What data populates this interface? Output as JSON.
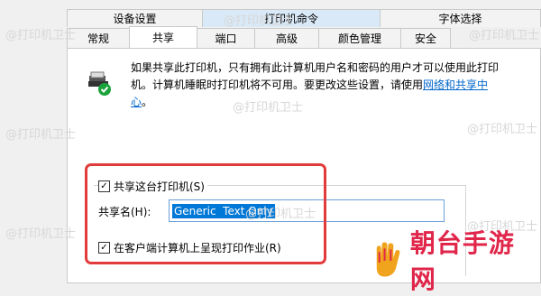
{
  "tabs_back": [
    "设备设置",
    "打印机命令",
    "字体选择"
  ],
  "tabs_front": [
    "常规",
    "共享",
    "端口",
    "高级",
    "颜色管理",
    "安全"
  ],
  "active_tab": "共享",
  "description": {
    "text": "如果共享此打印机，只有拥有此计算机用户名和密码的用户才可以使用此打印机。计算机睡眠时打印机将不可用。要更改这些设置，请使用",
    "link": "网络和共享中心",
    "end": "。"
  },
  "share_checkbox": {
    "label": "共享这台打印机(S)",
    "checked": true
  },
  "share_name": {
    "label": "共享名(H):",
    "value": "Generic  Text Only"
  },
  "render_checkbox": {
    "label": "在客户端计算机上呈现打印作业(R)",
    "checked": true
  },
  "watermark": "@打印机卫士",
  "brand": "朝台手游网",
  "colors": {
    "highlight_tab": "#d9e9f7",
    "selection": "#0078d7",
    "red_frame": "#e23b3b",
    "brand": "#e0264a",
    "link": "#0066cc"
  }
}
